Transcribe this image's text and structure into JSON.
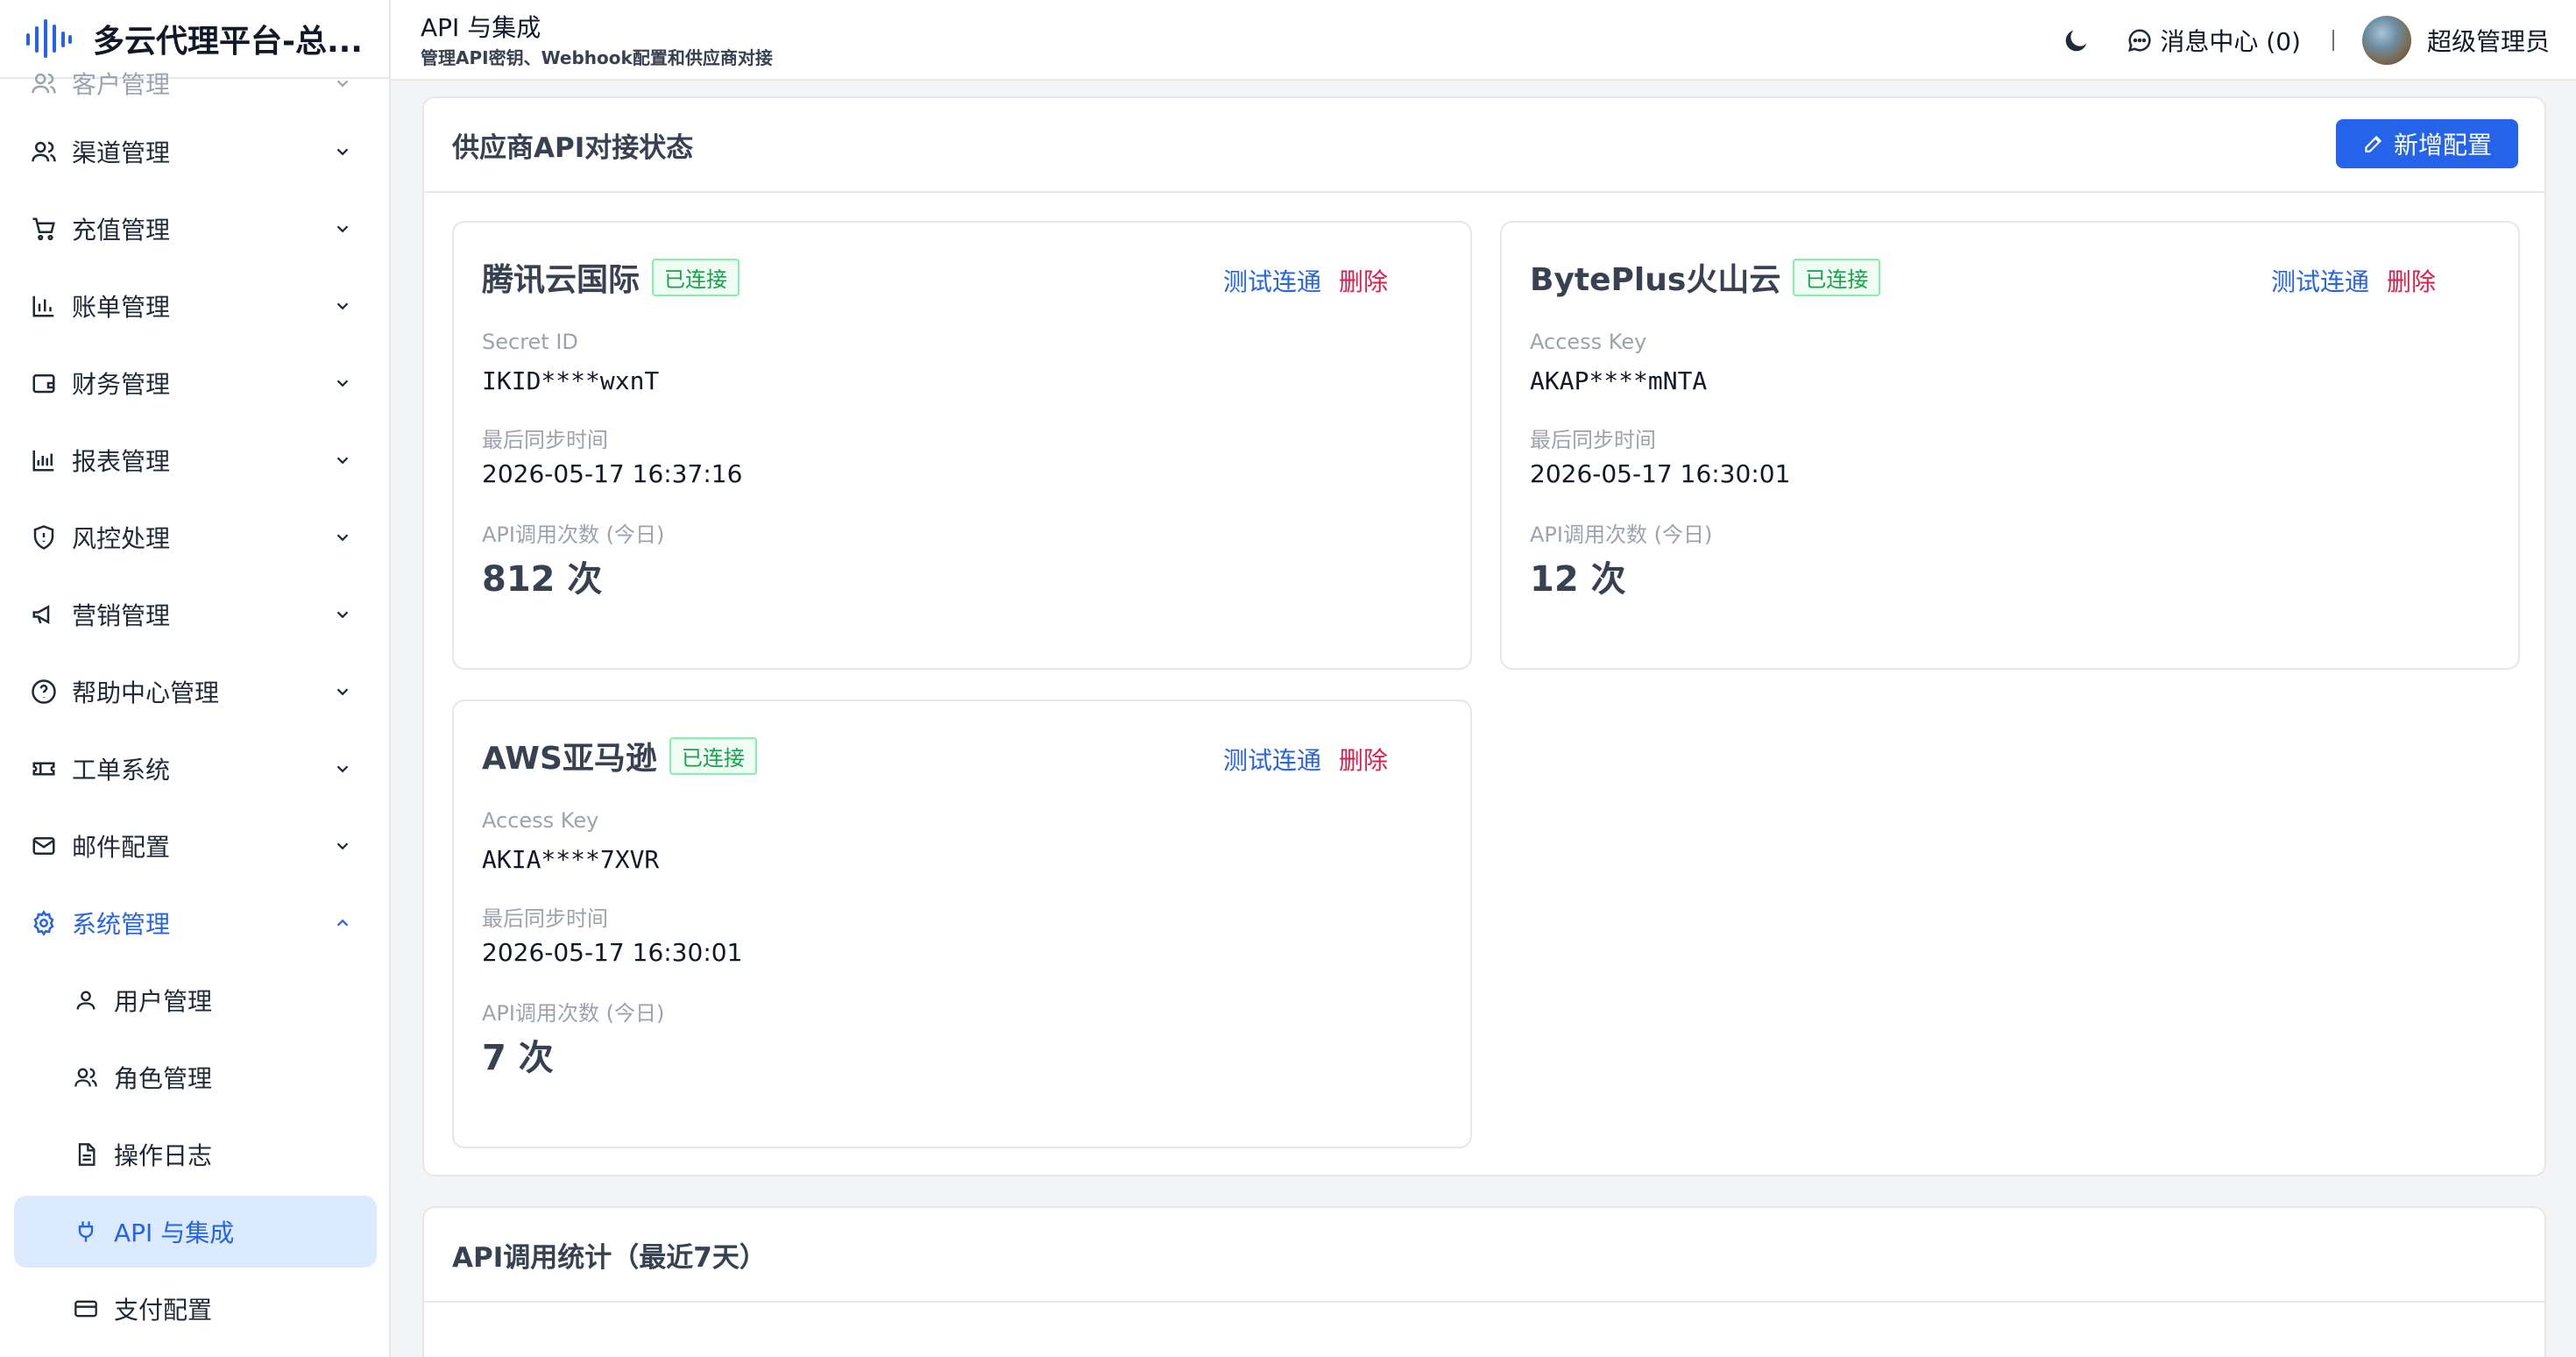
{
  "app": {
    "title": "多云代理平台-总..."
  },
  "header": {
    "page_title": "API 与集成",
    "page_subtitle": "管理API密钥、Webhook配置和供应商对接",
    "messages_label": "消息中心 (0)",
    "user_name": "超级管理员"
  },
  "sidebar": {
    "items": [
      {
        "label": "客户管理",
        "icon": "users-icon"
      },
      {
        "label": "渠道管理",
        "icon": "users-icon"
      },
      {
        "label": "充值管理",
        "icon": "cart-icon"
      },
      {
        "label": "账单管理",
        "icon": "bar-chart-icon"
      },
      {
        "label": "财务管理",
        "icon": "wallet-icon"
      },
      {
        "label": "报表管理",
        "icon": "bar-chart-icon"
      },
      {
        "label": "风控处理",
        "icon": "shield-icon"
      },
      {
        "label": "营销管理",
        "icon": "megaphone-icon"
      },
      {
        "label": "帮助中心管理",
        "icon": "help-icon"
      },
      {
        "label": "工单系统",
        "icon": "ticket-icon"
      },
      {
        "label": "邮件配置",
        "icon": "mail-icon"
      },
      {
        "label": "系统管理",
        "icon": "gear-icon"
      }
    ],
    "sub_items": [
      {
        "label": "用户管理",
        "icon": "user-icon"
      },
      {
        "label": "角色管理",
        "icon": "users-icon"
      },
      {
        "label": "操作日志",
        "icon": "file-icon"
      },
      {
        "label": "API 与集成",
        "icon": "plug-icon"
      },
      {
        "label": "支付配置",
        "icon": "card-icon"
      }
    ]
  },
  "vendors_panel": {
    "title": "供应商API对接状态",
    "add_button": "新增配置",
    "cards": [
      {
        "name": "腾讯云国际",
        "status": "已连接",
        "test_label": "测试连通",
        "delete_label": "删除",
        "key_label": "Secret ID",
        "key_value": "IKID****wxnT",
        "sync_label": "最后同步时间",
        "sync_value": "2026-05-17 16:37:16",
        "calls_label": "API调用次数 (今日)",
        "calls_value": "812 次"
      },
      {
        "name": "BytePlus火山云",
        "status": "已连接",
        "test_label": "测试连通",
        "delete_label": "删除",
        "key_label": "Access Key",
        "key_value": "AKAP****mNTA",
        "sync_label": "最后同步时间",
        "sync_value": "2026-05-17 16:30:01",
        "calls_label": "API调用次数 (今日)",
        "calls_value": "12 次"
      },
      {
        "name": "AWS亚马逊",
        "status": "已连接",
        "test_label": "测试连通",
        "delete_label": "删除",
        "key_label": "Access Key",
        "key_value": "AKIA****7XVR",
        "sync_label": "最后同步时间",
        "sync_value": "2026-05-17 16:30:01",
        "calls_label": "API调用次数 (今日)",
        "calls_value": "7 次"
      }
    ]
  },
  "stats_panel": {
    "title": "API调用统计（最近7天）"
  }
}
